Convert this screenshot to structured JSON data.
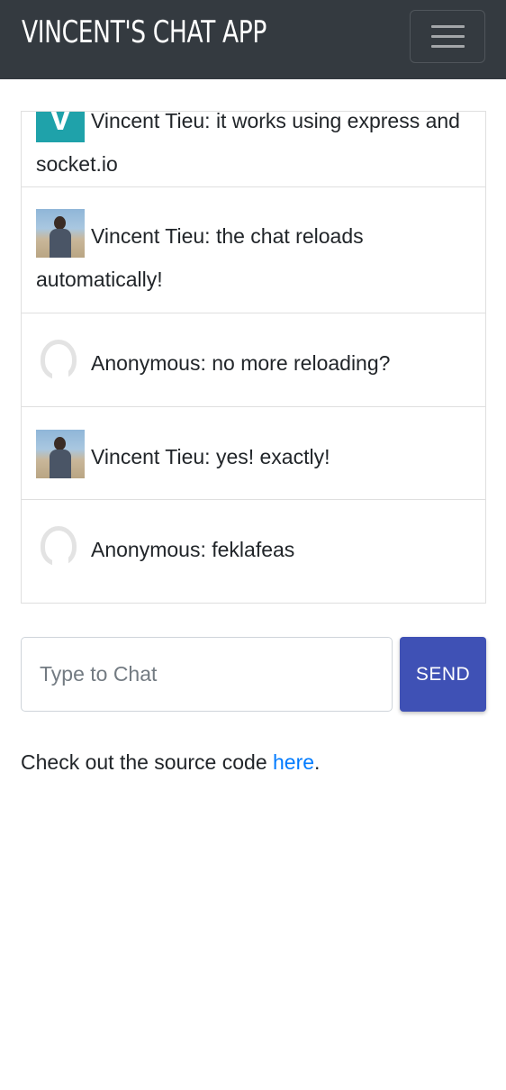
{
  "navbar": {
    "brand": "VINCENT'S CHAT APP",
    "toggle_icon": "hamburger-menu-icon",
    "background_color": "#343a40"
  },
  "chat": {
    "messages": [
      {
        "avatar": "V",
        "avatar_type": "letter",
        "text": "Vincent Tieu: it works using express and socket.io"
      },
      {
        "avatar": "photo",
        "avatar_type": "photo",
        "text": "Vincent Tieu: the chat reloads automatically!"
      },
      {
        "avatar": "anonymous",
        "avatar_type": "anonymous",
        "text": "Anonymous: no more reloading?"
      },
      {
        "avatar": "photo",
        "avatar_type": "photo",
        "text": "Vincent Tieu: yes! exactly!"
      },
      {
        "avatar": "anonymous",
        "avatar_type": "anonymous",
        "text": "Anonymous: feklafeas"
      }
    ]
  },
  "composer": {
    "placeholder": "Type to Chat",
    "value": "",
    "send_label": "SEND",
    "send_color": "#3f51b5"
  },
  "footer": {
    "prefix": "Check out the source code ",
    "link_text": "here",
    "suffix": ".",
    "link_color": "#007bff"
  }
}
